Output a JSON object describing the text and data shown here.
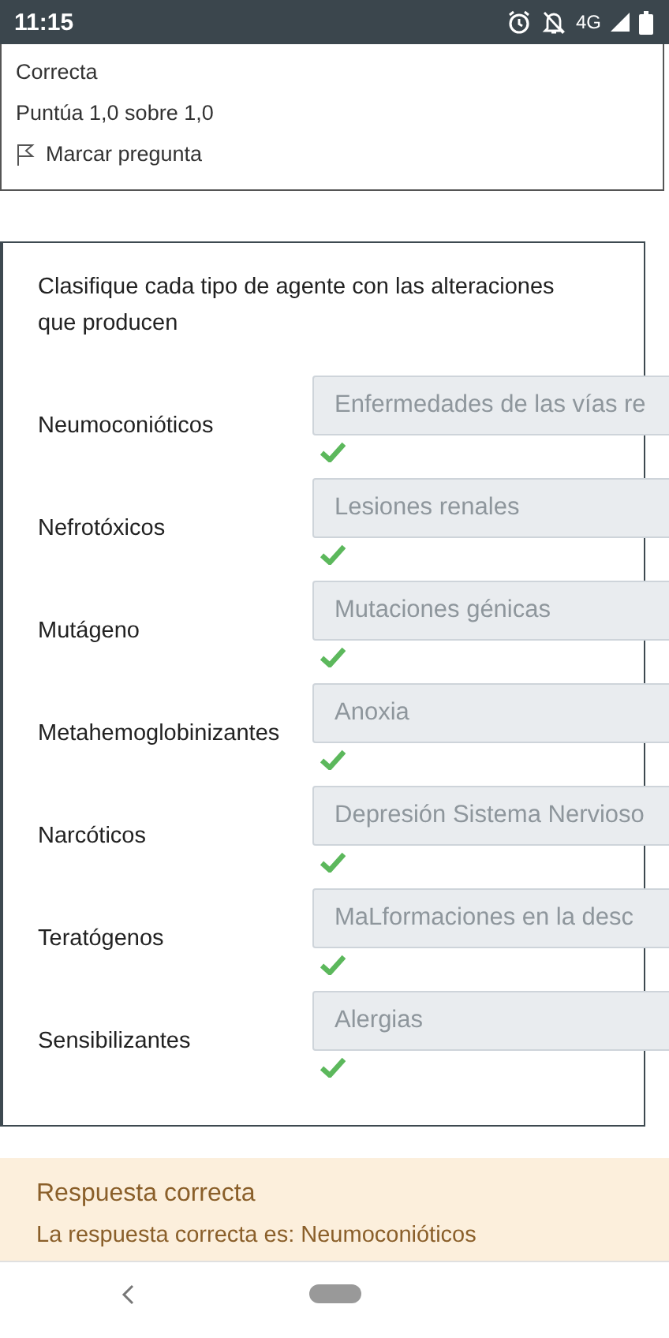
{
  "status_bar": {
    "time": "11:15",
    "network": "4G"
  },
  "info": {
    "state": "Correcta",
    "grade": "Puntúa 1,0 sobre 1,0",
    "flag_label": "Marcar pregunta"
  },
  "question": {
    "text": "Clasifique cada tipo de agente con  las alteraciones que producen",
    "rows": [
      {
        "label": "Neumoconióticos",
        "answer": "Enfermedades de las vías re",
        "correct": true
      },
      {
        "label": "Nefrotóxicos",
        "answer": "Lesiones renales",
        "correct": true
      },
      {
        "label": "Mutágeno",
        "answer": "Mutaciones génicas",
        "correct": true
      },
      {
        "label": "Metahemoglobinizantes",
        "answer": "Anoxia",
        "correct": true
      },
      {
        "label": "Narcóticos",
        "answer": "Depresión Sistema Nervioso",
        "correct": true
      },
      {
        "label": "Teratógenos",
        "answer": "MaLformaciones en la desc",
        "correct": true
      },
      {
        "label": "Sensibilizantes",
        "answer": "Alergias",
        "correct": true
      }
    ]
  },
  "feedback": {
    "title": "Respuesta correcta",
    "text": "La respuesta correcta es: Neumoconióticos"
  }
}
